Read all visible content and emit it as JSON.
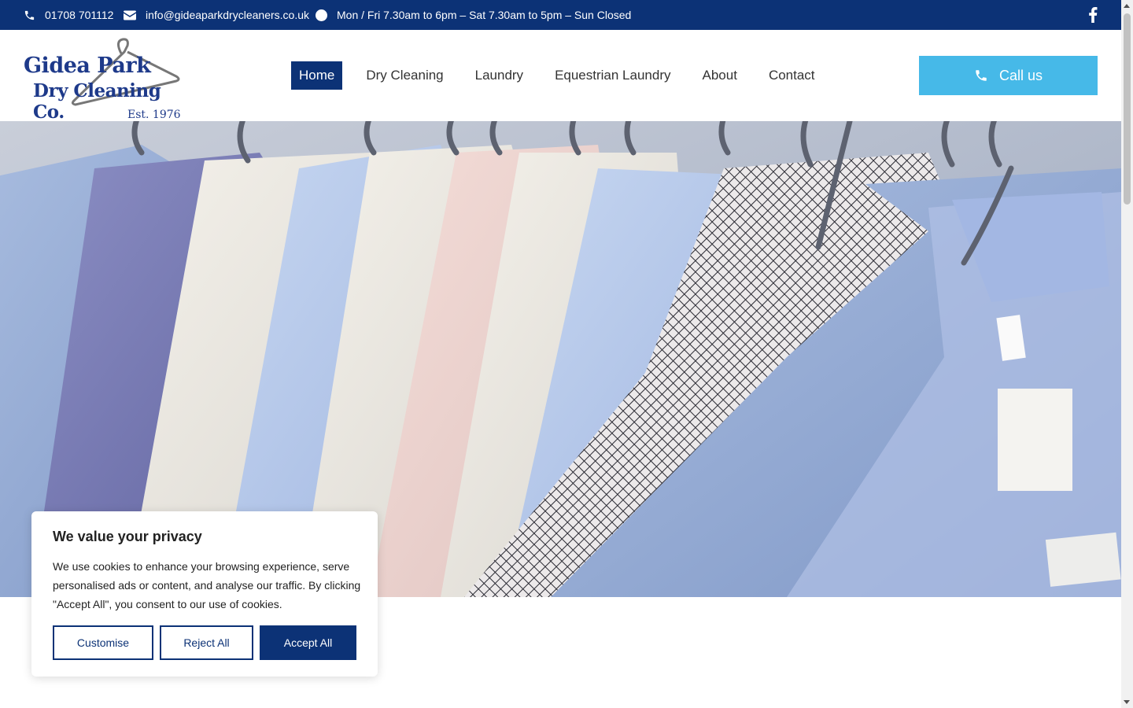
{
  "topbar": {
    "phone": "01708 701112",
    "email": "info@gideaparkdrycleaners.co.uk",
    "hours": "Mon / Fri 7.30am to 6pm – Sat 7.30am to 5pm – Sun Closed"
  },
  "logo": {
    "line1": "Gidea Park",
    "line2": "Dry Cleaning Co.",
    "line3": "Est. 1976"
  },
  "nav": {
    "items": [
      "Home",
      "Dry Cleaning",
      "Laundry",
      "Equestrian Laundry",
      "About",
      "Contact"
    ],
    "active": "Home"
  },
  "call_button": {
    "label": "Call us"
  },
  "cookie": {
    "title": "We value your privacy",
    "body": "We use cookies to enhance your browsing experience, serve personalised ads or content, and analyse our traffic. By clicking \"Accept All\", you consent to our use of cookies.",
    "customise": "Customise",
    "reject": "Reject All",
    "accept": "Accept All"
  },
  "colors": {
    "brand": "#0c3276",
    "accent": "#46b9e8"
  }
}
